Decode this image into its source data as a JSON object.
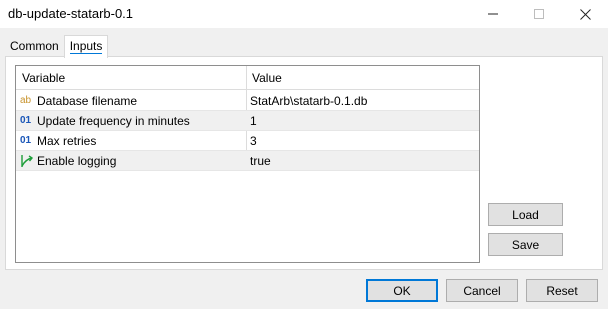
{
  "window": {
    "title": "db-update-statarb-0.1"
  },
  "tabs": [
    {
      "label": "Common"
    },
    {
      "label": "Inputs"
    }
  ],
  "grid": {
    "columns": {
      "variable": "Variable",
      "value": "Value"
    },
    "rows": [
      {
        "icon": "string-icon",
        "glyph": "ab",
        "name": "Database filename",
        "value": "StatArb\\statarb-0.1.db"
      },
      {
        "icon": "integer-icon",
        "glyph": "01",
        "name": "Update frequency in minutes",
        "value": "1"
      },
      {
        "icon": "integer-icon",
        "glyph": "01",
        "name": "Max retries",
        "value": "3"
      },
      {
        "icon": "boolean-icon",
        "glyph": "",
        "name": "Enable logging",
        "value": "true"
      }
    ]
  },
  "side_buttons": {
    "load_label": "Load",
    "save_label": "Save"
  },
  "footer_buttons": {
    "ok_label": "OK",
    "cancel_label": "Cancel",
    "reset_label": "Reset"
  },
  "colors": {
    "accent": "#0078d7",
    "string_icon": "#c8932c",
    "integer_icon": "#1a56b8",
    "boolean_icon": "#1e9e3a"
  }
}
